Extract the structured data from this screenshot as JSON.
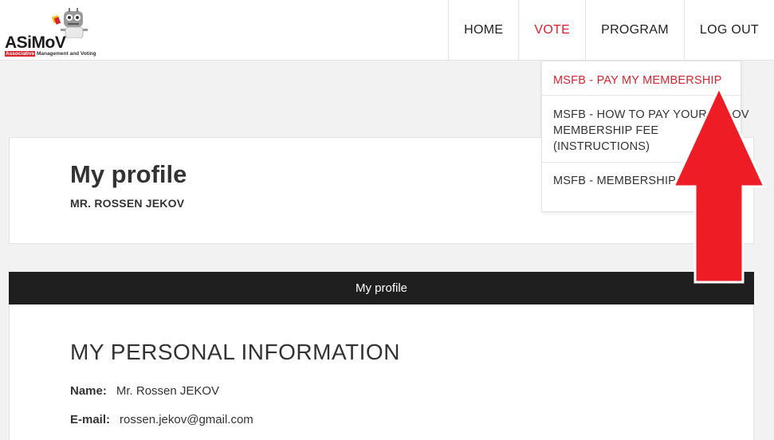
{
  "logo": {
    "name": "ASiMoV",
    "tag_highlight": "Associative",
    "tag_rest": " Management and Voting"
  },
  "nav": {
    "items": [
      {
        "label": "HOME"
      },
      {
        "label": "VOTE"
      },
      {
        "label": "PROGRAM"
      },
      {
        "label": "LOG OUT"
      }
    ],
    "active_index": 1
  },
  "dropdown": {
    "items": [
      {
        "label": "MSFB - PAY MY MEMBERSHIP"
      },
      {
        "label": "MSFB - HOW TO PAY YOUR JEKOV MEMBERSHIP FEE (INSTRUCTIONS)"
      },
      {
        "label": "MSFB - MEMBERSHIP CRITERIA"
      }
    ]
  },
  "header": {
    "title": "My profile",
    "subtitle": "MR. ROSSEN JEKOV"
  },
  "tab_bar": {
    "label": "My profile"
  },
  "personal": {
    "title": "MY PERSONAL INFORMATION",
    "name_label": "Name:",
    "name_value": "Mr. Rossen JEKOV",
    "email_label": "E-mail:",
    "email_value": "rossen.jekov@gmail.com"
  },
  "colors": {
    "accent": "#d9232e",
    "bar": "#1f1f1f",
    "arrow": "#ee1c25"
  },
  "icons": {
    "logo": "robot-mascot-icon",
    "annotation": "red-arrow-up-icon"
  }
}
